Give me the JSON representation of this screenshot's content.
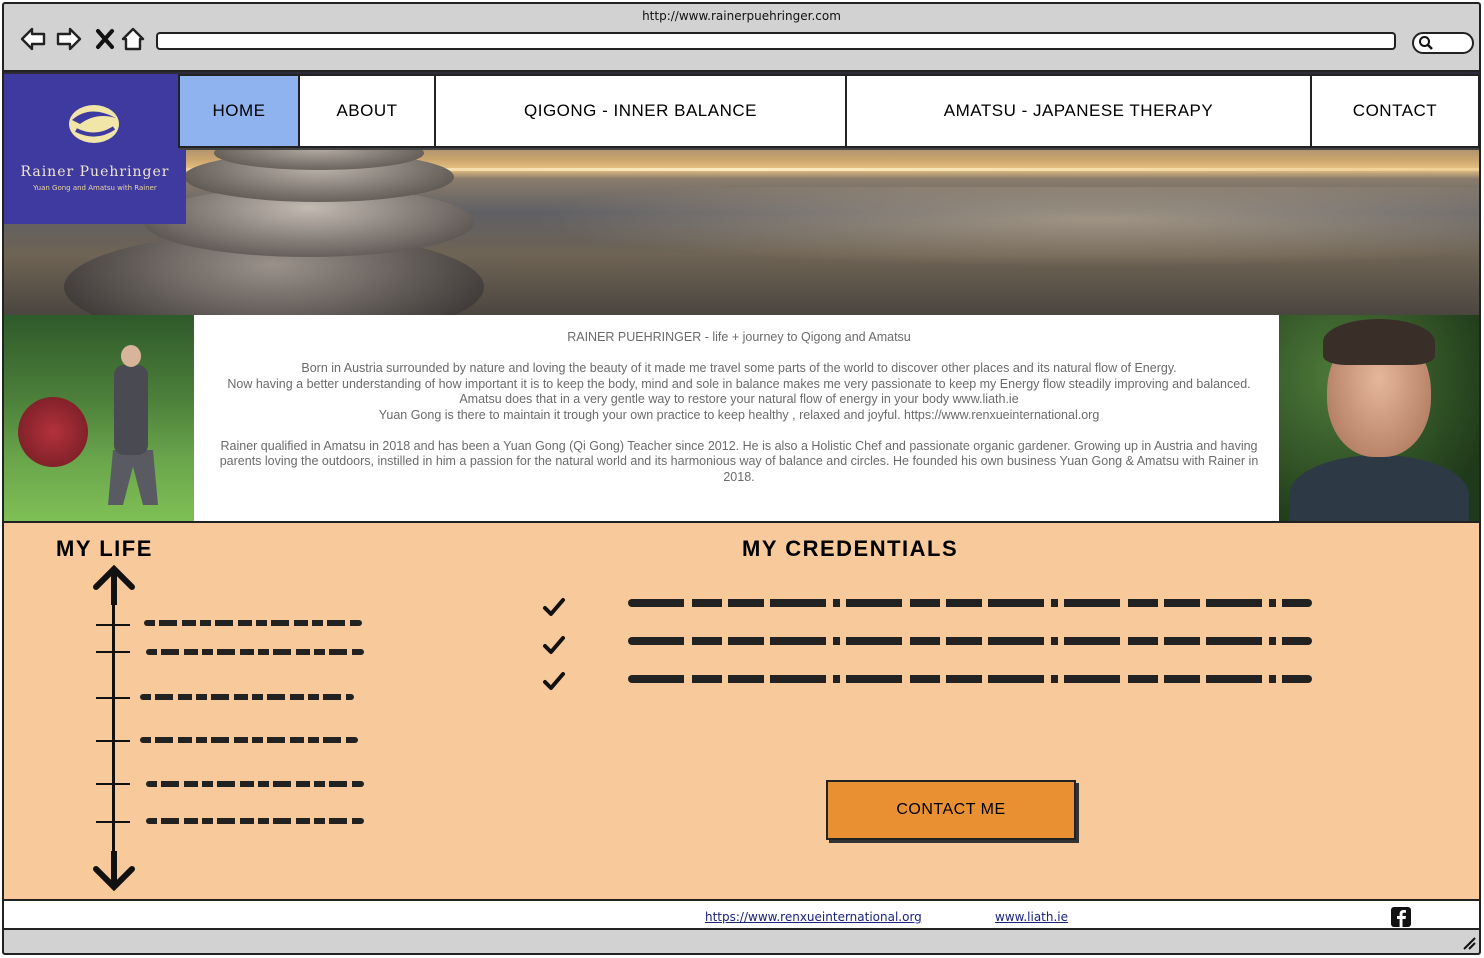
{
  "browser": {
    "url": "http://www.rainerpuehringer.com"
  },
  "logo": {
    "name": "Rainer Puehringer",
    "tagline": "Yuan Gong and Amatsu with Rainer"
  },
  "nav": {
    "items": [
      {
        "label": "HOME",
        "active": true
      },
      {
        "label": "ABOUT",
        "active": false
      },
      {
        "label": "QIGONG - INNER BALANCE",
        "active": false
      },
      {
        "label": "AMATSU - JAPANESE THERAPY",
        "active": false
      },
      {
        "label": "CONTACT",
        "active": false
      }
    ]
  },
  "intro": {
    "title": "RAINER PUEHRINGER - life + journey to Qigong and Amatsu",
    "para1_line1": "Born in Austria surrounded by nature and loving the beauty of it made me travel some parts of the world to discover other places and its natural flow of Energy.",
    "para1_line2": "Now having a better understanding of  how important it is to keep the body, mind and sole in balance makes me very passionate to keep my Energy flow steadily improving and balanced.",
    "para1_line3": "Amatsu does that in a very gentle way to restore your natural flow of energy in your body www.liath.ie",
    "para1_line4": "Yuan Gong is there to maintain it trough your own practice to keep healthy , relaxed and joyful. https://www.renxueinternational.org",
    "para2": "Rainer qualified in Amatsu in 2018 and has been a Yuan Gong (Qi Gong) Teacher since 2012. He is also a Holistic Chef and passionate organic gardener. Growing up in Austria and having parents loving the outdoors, instilled in him a passion for the natural world and its harmonious way of balance and circles. He founded his own business Yuan Gong & Amatsu with Rainer in 2018."
  },
  "life": {
    "heading": "MY LIFE"
  },
  "credentials": {
    "heading": "MY CREDENTIALS"
  },
  "cta": {
    "label": "CONTACT ME"
  },
  "footer": {
    "link1": "https://www.renxueinternational.org",
    "link2": "www.liath.ie"
  },
  "icons": {
    "back": "back-arrow-icon",
    "forward": "forward-arrow-icon",
    "stop": "close-icon",
    "home": "home-icon",
    "search": "search-icon",
    "facebook": "facebook-icon",
    "check": "check-icon"
  },
  "colors": {
    "logo_bg": "#3f3aa0",
    "nav_active": "#8fb3ee",
    "section_bg": "#f8c99a",
    "cta_bg": "#e89032",
    "intro_text": "#6b6b6b",
    "footer_link": "#1a237e"
  }
}
